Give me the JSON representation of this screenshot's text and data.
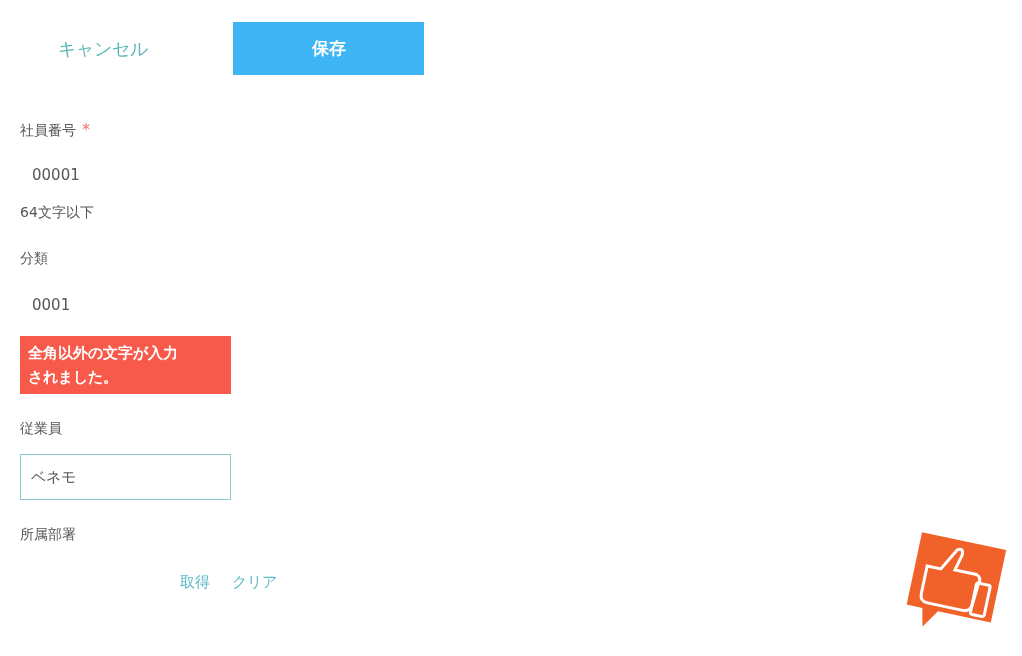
{
  "actions": {
    "cancel": "キャンセル",
    "save": "保存"
  },
  "fields": [
    {
      "kind": "display",
      "label": "社員番号",
      "required_mark": "*",
      "value": "00001",
      "hint": "64文字以下"
    },
    {
      "kind": "display",
      "label": "分類",
      "value": "0001",
      "error": "全角以外の文字が入力されました。"
    },
    {
      "kind": "input",
      "label": "従業員",
      "value": "ベネモ"
    },
    {
      "kind": "links",
      "label": "所属部署",
      "links": [
        "取得",
        "クリア"
      ]
    }
  ]
}
